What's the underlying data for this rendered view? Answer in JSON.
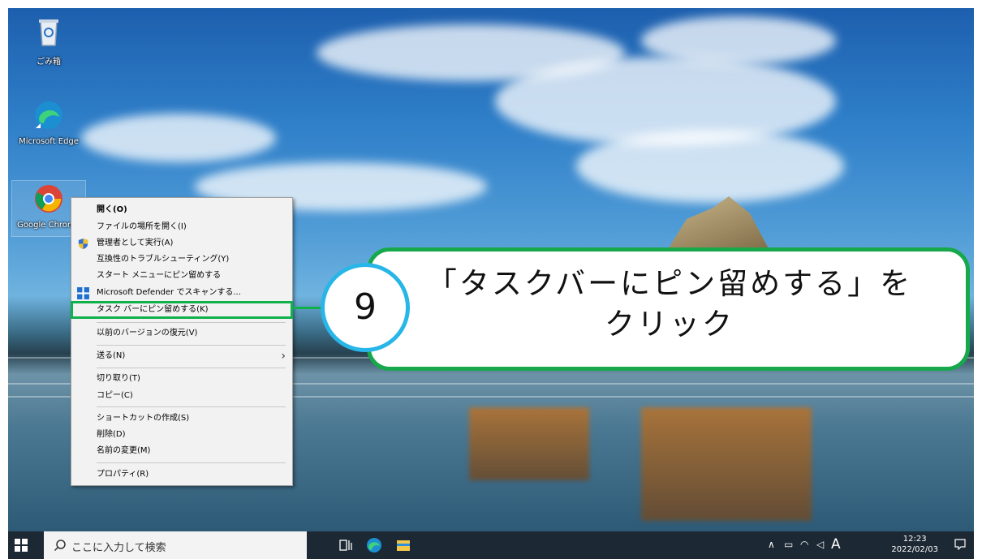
{
  "desktop": {
    "icons": [
      {
        "label": "ごみ箱"
      },
      {
        "label": "Microsoft Edge"
      },
      {
        "label": "Google Chrome"
      }
    ]
  },
  "context_menu": {
    "items": [
      {
        "label": "開く(O)"
      },
      {
        "label": "ファイルの場所を開く(I)"
      },
      {
        "label": "管理者として実行(A)"
      },
      {
        "label": "互換性のトラブルシューティング(Y)"
      },
      {
        "label": "スタート メニューにピン留めする"
      },
      {
        "label": "Microsoft Defender でスキャンする..."
      },
      {
        "label": "タスク バーにピン留めする(K)"
      },
      {
        "label": "以前のバージョンの復元(V)"
      },
      {
        "label": "送る(N)"
      },
      {
        "label": "切り取り(T)"
      },
      {
        "label": "コピー(C)"
      },
      {
        "label": "ショートカットの作成(S)"
      },
      {
        "label": "削除(D)"
      },
      {
        "label": "名前の変更(M)"
      },
      {
        "label": "プロパティ(R)"
      }
    ]
  },
  "callout": {
    "step": "9",
    "line1": "「タスクバーにピン留めする」を",
    "line2": "クリック"
  },
  "taskbar": {
    "search_placeholder": "ここに入力して検索",
    "ime": "A",
    "time": "12:23",
    "date": "2022/02/03"
  },
  "colors": {
    "highlight": "#10b04a",
    "callout_border": "#18a84c",
    "circle_border": "#28b6e8",
    "taskbar": "#1c2833"
  }
}
